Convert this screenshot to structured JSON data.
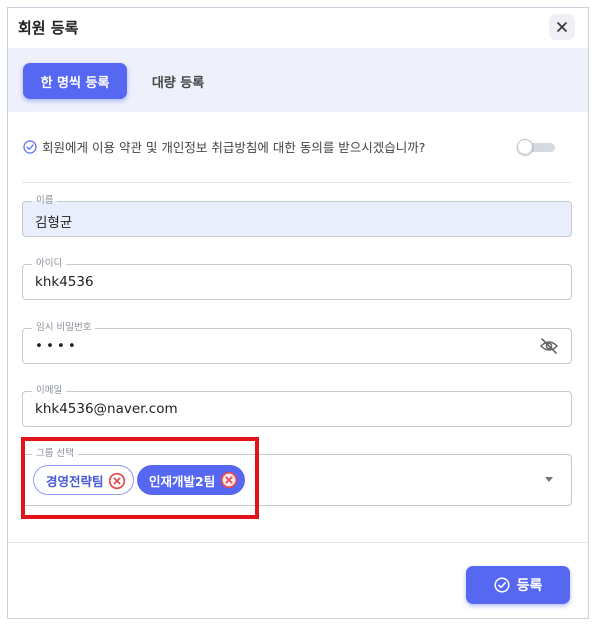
{
  "dialog": {
    "title": "회원 등록",
    "close_icon": "close-icon"
  },
  "tabs": [
    {
      "label": "한 명씩 등록",
      "active": true
    },
    {
      "label": "대량 등록",
      "active": false
    }
  ],
  "consent": {
    "icon": "check-circle-icon",
    "text": "회원에게 이용 약관 및 개인정보 취급방침에 대한 동의를 받으시겠습니까?",
    "toggle_on": false
  },
  "fields": {
    "name": {
      "label": "이름",
      "value": "김형균"
    },
    "id": {
      "label": "아이디",
      "value": "khk4536"
    },
    "password": {
      "label": "임시 비밀번호",
      "value": "••••",
      "icon": "eye-off-icon"
    },
    "email": {
      "label": "이메일",
      "value": "khk4536@naver.com"
    }
  },
  "group": {
    "label": "그룹 선택",
    "chips": [
      {
        "label": "경영전략팀",
        "style": "outline",
        "remove_icon": "remove-x-circle-icon"
      },
      {
        "label": "인재개발2팀",
        "style": "solid",
        "remove_icon": "remove-x-circle-icon"
      }
    ],
    "dropdown_icon": "chevron-down-icon"
  },
  "submit": {
    "label": "등록",
    "icon": "check-circle-icon"
  },
  "colors": {
    "accent": "#5668f2",
    "tab_bar_bg": "#eef0fb",
    "filled_field_bg": "#e8eefb",
    "remove_icon": "#e5484d",
    "highlight_border": "#e0121a"
  }
}
